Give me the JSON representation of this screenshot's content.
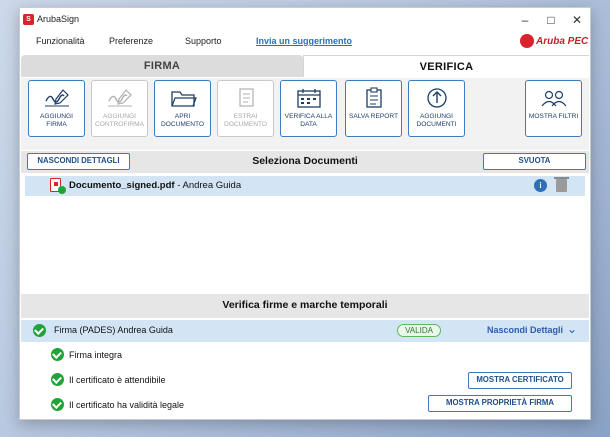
{
  "window": {
    "app_title": "ArubaSign",
    "app_icon_text": "S"
  },
  "window_controls": {
    "minimize": "–",
    "maximize": "□",
    "close": "✕"
  },
  "menu": {
    "items": [
      "Funzionalità",
      "Preferenze",
      "Supporto"
    ],
    "link": "Invia un suggerimento",
    "brand": "Aruba PEC"
  },
  "tabs": [
    {
      "label": "FIRMA",
      "active": false
    },
    {
      "label": "VERIFICA",
      "active": true
    }
  ],
  "toolbar": {
    "buttons": [
      {
        "label": "AGGIUNGI FIRMA",
        "icon": "signature-icon",
        "enabled": true
      },
      {
        "label": "AGGIUNGI CONTROFIRMA",
        "icon": "countersignature-icon",
        "enabled": false
      },
      {
        "label": "APRI DOCUMENTO",
        "icon": "folder-icon",
        "enabled": true
      },
      {
        "label": "ESTRAI DOCUMENTO",
        "icon": "extract-icon",
        "enabled": false
      },
      {
        "label": "VERIFICA ALLA DATA",
        "icon": "calendar-icon",
        "enabled": true
      },
      {
        "label": "SALVA REPORT",
        "icon": "report-icon",
        "enabled": true
      },
      {
        "label": "AGGIUNGI DOCUMENTI",
        "icon": "upload-icon",
        "enabled": true
      },
      {
        "label": "MOSTRA FILTRI",
        "icon": "users-icon",
        "enabled": true
      }
    ]
  },
  "documents_section": {
    "hide_details_label": "NASCONDI DETTAGLI",
    "title": "Seleziona Documenti",
    "clear_label": "SVUOTA",
    "files": [
      {
        "filename": "Documento_signed.pdf",
        "signer": " - Andrea Guida"
      }
    ]
  },
  "verification_section": {
    "title": "Verifica firme e marche temporali",
    "signature": {
      "text": "Firma (PADES) Andrea Guida",
      "status": "VALIDA",
      "toggle_label": "Nascondi Dettagli"
    },
    "details": [
      {
        "text": "Firma integra",
        "button": ""
      },
      {
        "text": "Il certificato è attendibile",
        "button": "MOSTRA CERTIFICATO"
      },
      {
        "text": "Il certificato ha validità legale",
        "button": "MOSTRA PROPRIETÀ FIRMA"
      }
    ]
  },
  "colors": {
    "accent": "#3a7bc1",
    "valid_green": "#22a33a",
    "brand_red": "#d9232d",
    "selection_blue": "#d3e4f5"
  }
}
